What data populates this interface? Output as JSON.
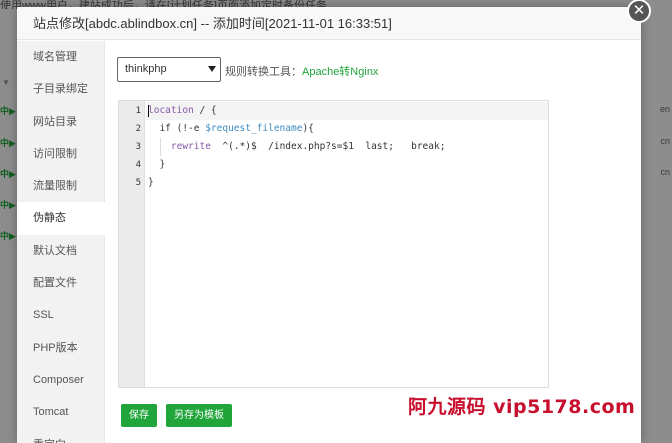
{
  "background": {
    "notice": "使用www用户，建站成功后，请在[计划任务]页面添加定时备份任务",
    "row_flag": "中▶",
    "right_labels": [
      "en",
      "cn",
      "cn"
    ]
  },
  "dialog": {
    "title": "站点修改[abdc.ablindbox.cn] -- 添加时间[2021-11-01 16:33:51]",
    "close_glyph": "✕"
  },
  "sidebar": {
    "items": [
      {
        "label": "域名管理"
      },
      {
        "label": "子目录绑定"
      },
      {
        "label": "网站目录"
      },
      {
        "label": "访问限制"
      },
      {
        "label": "流量限制"
      },
      {
        "label": "伪静态"
      },
      {
        "label": "默认文档"
      },
      {
        "label": "配置文件"
      },
      {
        "label": "SSL"
      },
      {
        "label": "PHP版本"
      },
      {
        "label": "Composer"
      },
      {
        "label": "Tomcat"
      },
      {
        "label": "重定向"
      }
    ],
    "active_index": 5
  },
  "rewrite": {
    "selected_template": "thinkphp",
    "rule_tool_label": "规则转换工具：",
    "rule_tool_link": "Apache转Nginx"
  },
  "editor": {
    "line_numbers": [
      "1",
      "2",
      "3",
      "4",
      "5"
    ],
    "lines": [
      {
        "keyword": "location",
        "rest": " / {"
      },
      {
        "pre": "  if (!-e ",
        "var": "$request_filename",
        "post": "){"
      },
      {
        "pre": "    ",
        "keyword": "rewrite",
        "rest": "  ^(.*)$  /index.php?s=$1  last;   break;"
      },
      {
        "text": "  }"
      },
      {
        "text": "}"
      }
    ]
  },
  "buttons": {
    "save": "保存",
    "save_as_template": "另存为模板"
  },
  "watermark": "阿九源码 vip5178.com",
  "colors": {
    "accent": "#20a53a",
    "keyword": "#8959a8",
    "variable": "#3e8abf",
    "watermark": "#c8102e"
  }
}
